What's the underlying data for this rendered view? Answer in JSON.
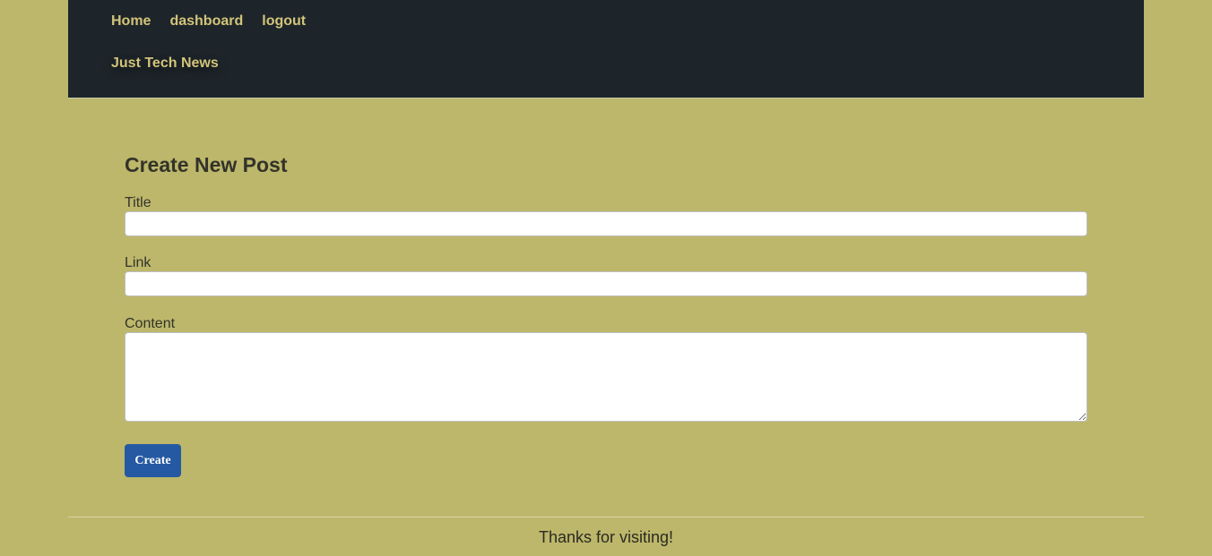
{
  "nav": {
    "items": [
      {
        "label": "Home"
      },
      {
        "label": "dashboard"
      },
      {
        "label": "logout"
      }
    ],
    "brand": "Just Tech News"
  },
  "form": {
    "title": "Create New Post",
    "title_label": "Title",
    "title_value": "",
    "link_label": "Link",
    "link_value": "",
    "content_label": "Content",
    "content_value": "",
    "submit_label": "Create"
  },
  "footer": {
    "text": "Thanks for visiting!"
  },
  "colors": {
    "background": "#bdb76b",
    "header": "#1e252a",
    "nav_link": "#d2c47a",
    "button": "#2559a2"
  }
}
